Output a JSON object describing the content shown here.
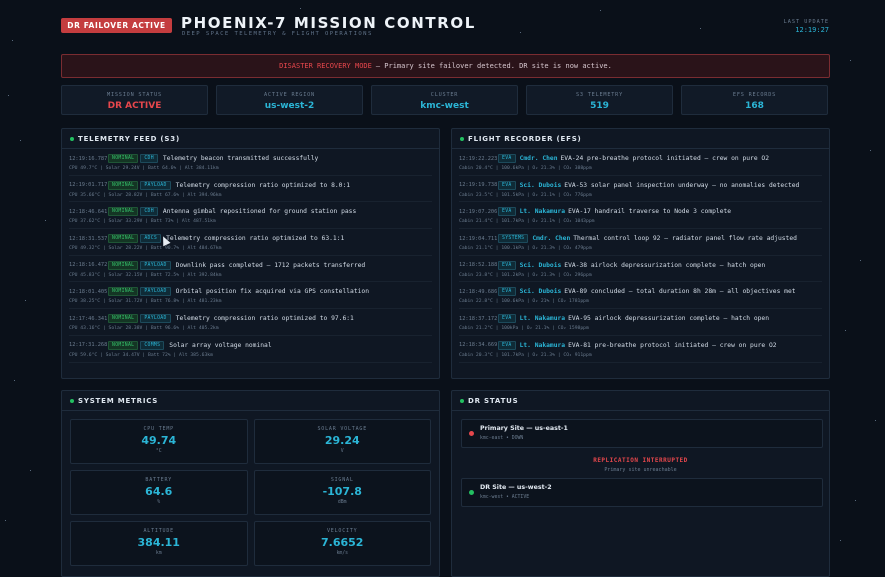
{
  "header": {
    "failover_badge": "DR FAILOVER ACTIVE",
    "title": "PHOENIX-7 MISSION CONTROL",
    "subtitle": "DEEP SPACE TELEMETRY & FLIGHT OPERATIONS",
    "last_update_label": "LAST UPDATE",
    "last_update_value": "12:19:27"
  },
  "alert": {
    "strong": "DISASTER RECOVERY MODE",
    "text": "— Primary site failover detected. DR site is now active."
  },
  "stats": [
    {
      "label": "MISSION STATUS",
      "value": "DR ACTIVE",
      "color": "#e6474c"
    },
    {
      "label": "ACTIVE REGION",
      "value": "us-west-2",
      "color": "#2bb5d6"
    },
    {
      "label": "CLUSTER",
      "value": "kmc-west",
      "color": "#2bb5d6"
    },
    {
      "label": "S3 TELEMETRY",
      "value": "519",
      "color": "#2bb5d6"
    },
    {
      "label": "EFS RECORDS",
      "value": "168",
      "color": "#2bb5d6"
    }
  ],
  "telemetry": {
    "title": "TELEMETRY FEED (S3)",
    "rows": [
      {
        "time": "12:19:16.787",
        "status": "NOMINAL",
        "sub": "CDH",
        "msg": "Telemetry beacon transmitted successfully",
        "detail": "CPU 49.7°C | Solar 29.24V | Batt 64.6% | Alt 384.11km"
      },
      {
        "time": "12:19:01.717",
        "status": "NOMINAL",
        "sub": "PAYLOAD",
        "msg": "Telemetry compression ratio optimized to 8.0:1",
        "detail": "CPU 35.66°C | Solar 28.82V | Batt 67.6% | Alt 394.96km"
      },
      {
        "time": "12:18:46.641",
        "status": "NOMINAL",
        "sub": "CDH",
        "msg": "Antenna gimbal repositioned for ground station pass",
        "detail": "CPU 37.62°C | Solar 33.29V | Batt 73% | Alt 487.51km"
      },
      {
        "time": "12:18:31.537",
        "status": "NOMINAL",
        "sub": "ADCS",
        "msg": "Telemetry compression ratio optimized to 63.1:1",
        "detail": "CPU 49.32°C | Solar 28.22V | Batt 90.7% | Alt 484.67km"
      },
      {
        "time": "12:18:16.472",
        "status": "NOMINAL",
        "sub": "PAYLOAD",
        "msg": "Downlink pass completed — 1712 packets transferred",
        "detail": "CPU 45.83°C | Solar 32.15V | Batt 72.5% | Alt 392.84km"
      },
      {
        "time": "12:18:01.405",
        "status": "NOMINAL",
        "sub": "PAYLOAD",
        "msg": "Orbital position fix acquired via GPS constellation",
        "detail": "CPU 38.25°C | Solar 31.72V | Batt 76.8% | Alt 481.23km"
      },
      {
        "time": "12:17:46.341",
        "status": "NOMINAL",
        "sub": "PAYLOAD",
        "msg": "Telemetry compression ratio optimized to 97.6:1",
        "detail": "CPU 43.16°C | Solar 28.38V | Batt 96.6% | Alt 405.2km"
      },
      {
        "time": "12:17:31.268",
        "status": "NOMINAL",
        "sub": "COMMS",
        "msg": "Solar array voltage nominal",
        "detail": "CPU 59.6°C | Solar 34.47V | Batt 72% | Alt 385.63km"
      }
    ]
  },
  "recorder": {
    "title": "FLIGHT RECORDER (EFS)",
    "rows": [
      {
        "time": "12:19:22.223",
        "tag": "EVA",
        "who": "Cmdr. Chen",
        "msg": "EVA-24 pre-breathe protocol initiated — crew on pure O2",
        "detail": "Cabin 20.4°C | 100.6kPa | O₂ 21.3% | CO₂ 388ppm"
      },
      {
        "time": "12:19:19.738",
        "tag": "EVA",
        "who": "Sci. Dubois",
        "msg": "EVA-53 solar panel inspection underway — no anomalies detected",
        "detail": "Cabin 23.5°C | 101.5kPa | O₂ 21.1% | CO₂ 776ppm"
      },
      {
        "time": "12:19:07.206",
        "tag": "EVA",
        "who": "Lt. Nakamura",
        "msg": "EVA-17 handrail traverse to Node 3 complete",
        "detail": "Cabin 21.4°C | 101.7kPa | O₂ 21.1% | CO₂ 1043ppm"
      },
      {
        "time": "12:19:04.711",
        "tag": "SYSTEMS",
        "who": "Cmdr. Chen",
        "msg": "Thermal control loop 92 — radiator panel flow rate adjusted",
        "detail": "Cabin 21.1°C | 100.1kPa | O₂ 21.3% | CO₂ 479ppm"
      },
      {
        "time": "12:18:52.188",
        "tag": "EVA",
        "who": "Sci. Dubois",
        "msg": "EVA-38 airlock depressurization complete — hatch open",
        "detail": "Cabin 23.8°C | 101.2kPa | O₂ 21.3% | CO₂ 296ppm"
      },
      {
        "time": "12:18:49.686",
        "tag": "EVA",
        "who": "Sci. Dubois",
        "msg": "EVA-89 concluded — total duration 8h 28m — all objectives met",
        "detail": "Cabin 22.8°C | 100.6kPa | O₂ 21% | CO₂ 1781ppm"
      },
      {
        "time": "12:18:37.172",
        "tag": "EVA",
        "who": "Lt. Nakamura",
        "msg": "EVA-95 airlock depressurization complete — hatch open",
        "detail": "Cabin 21.2°C | 100kPa | O₂ 21.1% | CO₂ 1598ppm"
      },
      {
        "time": "12:18:34.669",
        "tag": "EVA",
        "who": "Lt. Nakamura",
        "msg": "EVA-81 pre-breathe protocol initiated — crew on pure O2",
        "detail": "Cabin 20.3°C | 101.7kPa | O₂ 21.3% | CO₂ 911ppm"
      }
    ]
  },
  "metrics": {
    "title": "SYSTEM METRICS",
    "items": [
      {
        "label": "CPU TEMP",
        "value": "49.74",
        "unit": "°C"
      },
      {
        "label": "SOLAR VOLTAGE",
        "value": "29.24",
        "unit": "V"
      },
      {
        "label": "BATTERY",
        "value": "64.6",
        "unit": "%"
      },
      {
        "label": "SIGNAL",
        "value": "-107.8",
        "unit": "dBm"
      },
      {
        "label": "ALTITUDE",
        "value": "384.11",
        "unit": "km"
      },
      {
        "label": "VELOCITY",
        "value": "7.6652",
        "unit": "km/s"
      }
    ]
  },
  "dr": {
    "title": "DR STATUS",
    "primary_name": "Primary Site — us-east-1",
    "primary_sub": "kmc-east • DOWN",
    "primary_color": "#e6474c",
    "repl_title": "REPLICATION INTERRUPTED",
    "repl_sub": "Primary site unreachable",
    "dr_name": "DR Site — us-west-2",
    "dr_sub": "kmc-west • ACTIVE",
    "dr_color": "#23c061"
  }
}
